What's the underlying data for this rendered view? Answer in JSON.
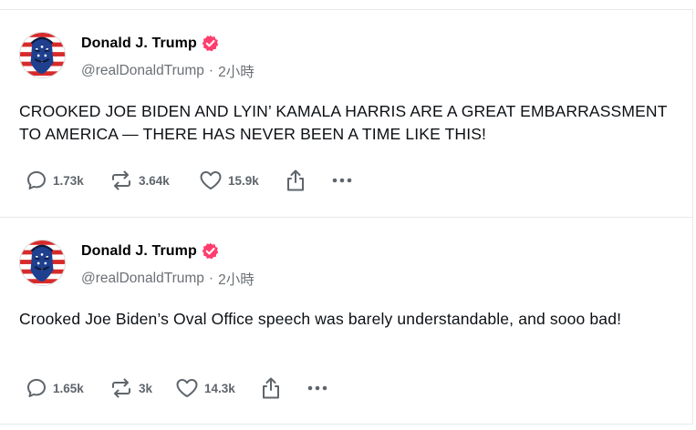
{
  "posts": [
    {
      "author": {
        "display_name": "Donald J. Trump",
        "handle": "@realDonaldTrump",
        "verified": true,
        "verified_color": "#ff3d6e"
      },
      "timestamp": "2小時",
      "separator": "·",
      "text": "CROOKED JOE BIDEN AND LYIN’ KAMALA HARRIS ARE A GREAT EMBARRASSMENT TO AMERICA — THERE HAS NEVER BEEN A TIME LIKE THIS!",
      "stats": {
        "replies": "1.73k",
        "reposts": "3.64k",
        "likes": "15.9k"
      }
    },
    {
      "author": {
        "display_name": "Donald J. Trump",
        "handle": "@realDonaldTrump",
        "verified": true,
        "verified_color": "#ff3d6e"
      },
      "timestamp": "2小時",
      "separator": "·",
      "text": "Crooked Joe Biden’s Oval Office speech was barely understandable, and sooo bad!",
      "stats": {
        "replies": "1.65k",
        "reposts": "3k",
        "likes": "14.3k"
      }
    }
  ],
  "icons": {
    "reply": "comment-bubble-icon",
    "repost": "repost-arrows-icon",
    "like": "heart-icon",
    "share": "share-upload-icon",
    "more": "more-dots-icon"
  }
}
